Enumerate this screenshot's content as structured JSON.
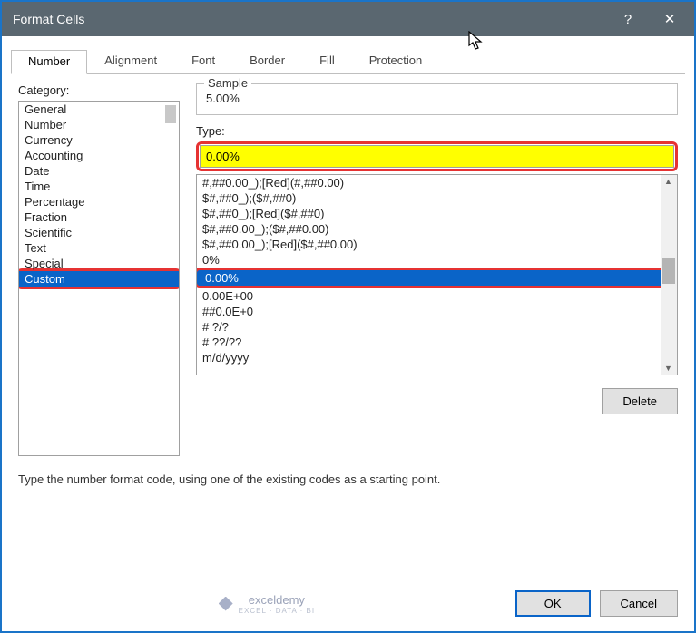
{
  "title": "Format Cells",
  "tabs": [
    "Number",
    "Alignment",
    "Font",
    "Border",
    "Fill",
    "Protection"
  ],
  "activeTab": 0,
  "categoryLabel": "Category:",
  "categories": [
    "General",
    "Number",
    "Currency",
    "Accounting",
    "Date",
    "Time",
    "Percentage",
    "Fraction",
    "Scientific",
    "Text",
    "Special",
    "Custom"
  ],
  "selectedCategoryIndex": 11,
  "sampleLabel": "Sample",
  "sampleValue": "5.00%",
  "typeLabel": "Type:",
  "typeValue": "0.00%",
  "typeList": [
    "#,##0.00_);[Red](#,##0.00)",
    "$#,##0_);($#,##0)",
    "$#,##0_);[Red]($#,##0)",
    "$#,##0.00_);($#,##0.00)",
    "$#,##0.00_);[Red]($#,##0.00)",
    "0%",
    "0.00%",
    "0.00E+00",
    "##0.0E+0",
    "# ?/?",
    "# ??/??",
    "m/d/yyyy"
  ],
  "selectedTypeIndex": 6,
  "deleteLabel": "Delete",
  "helpText": "Type the number format code, using one of the existing codes as a starting point.",
  "brand": {
    "name": "exceldemy",
    "tag": "EXCEL · DATA · BI"
  },
  "okLabel": "OK",
  "cancelLabel": "Cancel",
  "helpSymbol": "?",
  "closeSymbol": "✕"
}
